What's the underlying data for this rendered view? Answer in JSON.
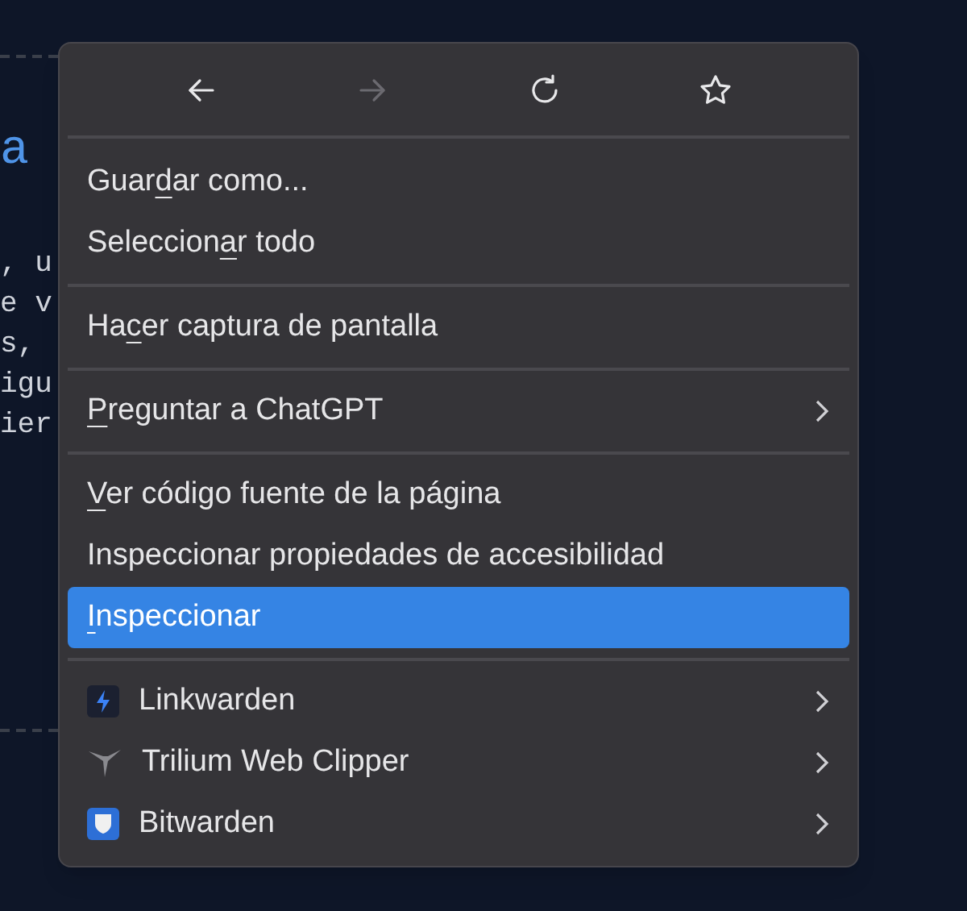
{
  "page": {
    "heading": "a",
    "lines": [
      ", u",
      "e v",
      "s,",
      "igu",
      "ier"
    ]
  },
  "menu": {
    "nav": [
      {
        "kind": "back",
        "disabled": false
      },
      {
        "kind": "forward",
        "disabled": true
      },
      {
        "kind": "reload",
        "disabled": false
      },
      {
        "kind": "bookmark",
        "disabled": false
      }
    ],
    "items": [
      {
        "kind": "item",
        "before": "Guar",
        "key": "d",
        "after": "ar como...",
        "submenu": false,
        "selected": false
      },
      {
        "kind": "item",
        "before": "Seleccion",
        "key": "a",
        "after": "r todo",
        "submenu": false,
        "selected": false
      },
      {
        "kind": "separator"
      },
      {
        "kind": "item",
        "before": "Ha",
        "key": "c",
        "after": "er captura de pantalla",
        "submenu": false,
        "selected": false
      },
      {
        "kind": "separator"
      },
      {
        "kind": "item",
        "key": "P",
        "after": "reguntar a ChatGPT",
        "submenu": true,
        "selected": false
      },
      {
        "kind": "separator"
      },
      {
        "kind": "item",
        "key": "V",
        "after": "er código fuente de la página",
        "submenu": false,
        "selected": false
      },
      {
        "kind": "item",
        "before": "Inspeccionar propiedades de accesibilidad",
        "submenu": false,
        "selected": false
      },
      {
        "kind": "item",
        "key": "I",
        "after": "nspeccionar",
        "submenu": false,
        "selected": true
      },
      {
        "kind": "separator"
      },
      {
        "kind": "extension",
        "before": "Linkwarden",
        "submenu": true,
        "selected": false
      },
      {
        "kind": "extension",
        "before": "Trilium Web Clipper",
        "submenu": true,
        "selected": false
      },
      {
        "kind": "extension",
        "before": "Bitwarden",
        "submenu": true,
        "selected": false
      }
    ]
  }
}
